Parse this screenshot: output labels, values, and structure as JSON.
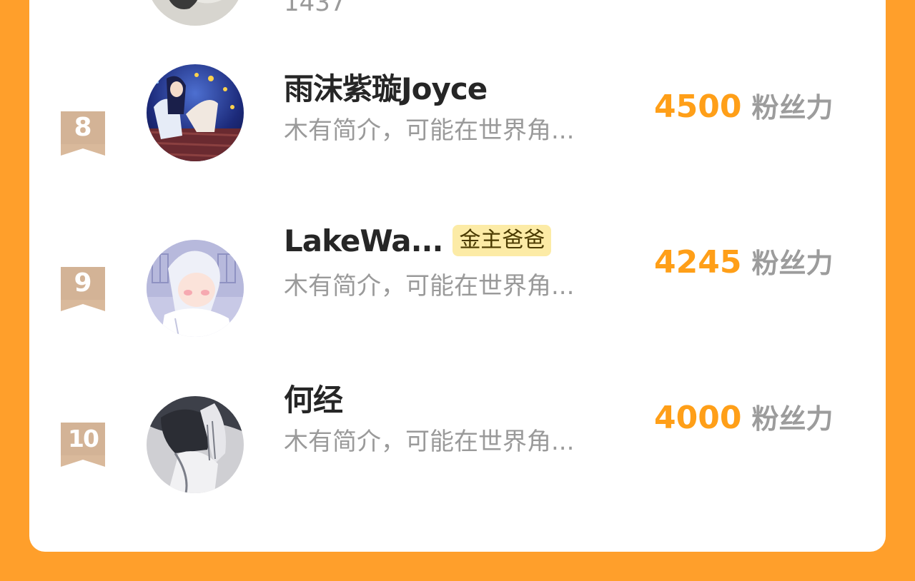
{
  "partial_top": {
    "followers_text": "1437"
  },
  "rows": [
    {
      "rank": "8",
      "name": "雨沫紫璇Joyce",
      "tag": "",
      "bio": "木有简介，可能在世界角...",
      "score": "4500",
      "unit": "粉丝力"
    },
    {
      "rank": "9",
      "name": "LakeWa...",
      "tag": "金主爸爸",
      "bio": "木有简介，可能在世界角...",
      "score": "4245",
      "unit": "粉丝力"
    },
    {
      "rank": "10",
      "name": "何经",
      "tag": "",
      "bio": "木有简介，可能在世界角...",
      "score": "4000",
      "unit": "粉丝力"
    }
  ],
  "colors": {
    "background": "#FF9F2B",
    "score": "#FF9F18",
    "badge": "#D9B99B",
    "tag_bg": "#FCEBA6"
  }
}
